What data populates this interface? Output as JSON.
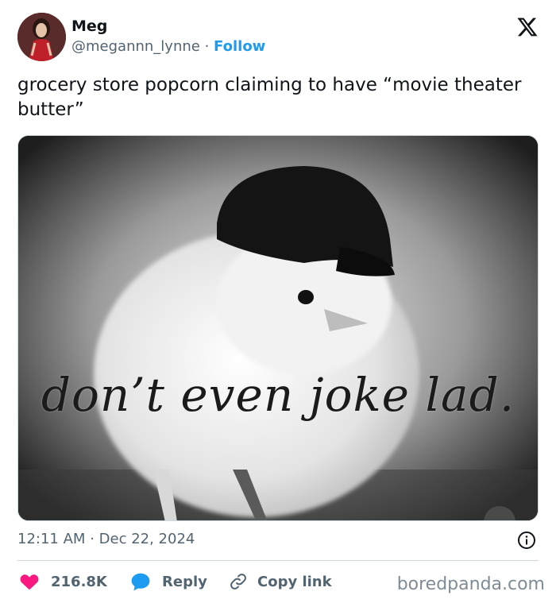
{
  "author": {
    "name": "Meg",
    "handle": "@megannn_lynne",
    "separator": "·",
    "follow_label": "Follow"
  },
  "icons": {
    "platform": "x-logo-icon",
    "info": "info-icon",
    "like": "heart-icon",
    "reply": "speech-bubble-icon",
    "copy": "link-icon"
  },
  "tweet": {
    "text": "grocery store popcorn claiming to have “movie theater butter”"
  },
  "media": {
    "caption": "don’t even joke lad."
  },
  "meta": {
    "time": "12:11 AM",
    "separator": "·",
    "date": "Dec 22, 2024"
  },
  "actions": {
    "likes": "216.8K",
    "reply_label": "Reply",
    "copy_label": "Copy link"
  },
  "watermark": "boredpanda.com",
  "colors": {
    "like": "#f91880",
    "reply": "#1d9bf0",
    "follow": "#1d9bf0",
    "muted": "#536471"
  }
}
